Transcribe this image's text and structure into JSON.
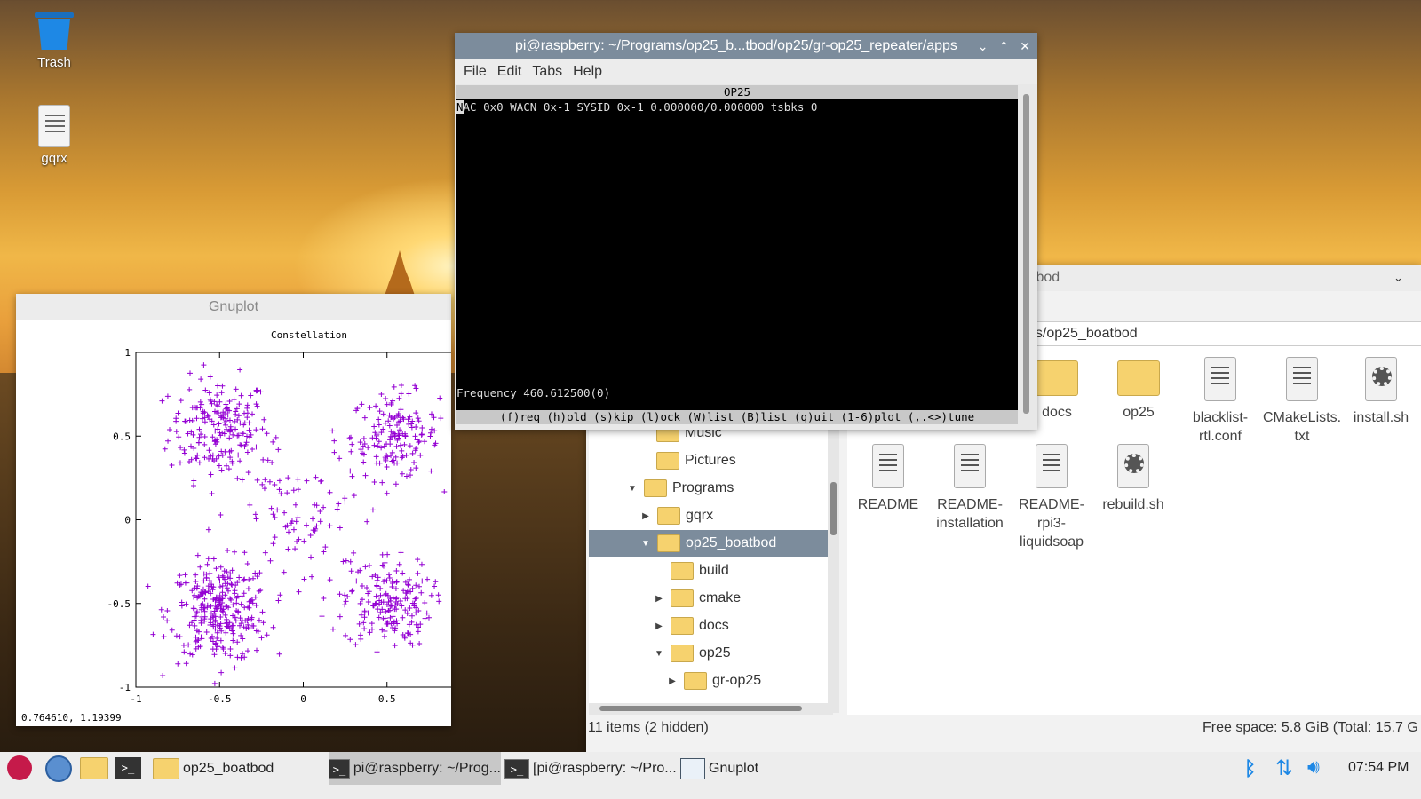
{
  "desktop": {
    "icons": [
      {
        "label": "Trash"
      },
      {
        "label": "gqrx"
      }
    ]
  },
  "gnuplot": {
    "window_title": "Gnuplot",
    "status_coords": "0.764610,  1.19399",
    "chart_data": {
      "type": "scatter",
      "title": "Constellation",
      "xlabel": "",
      "ylabel": "",
      "xlim": [
        -1,
        1
      ],
      "ylim": [
        -1,
        1
      ],
      "xticks": [
        "-1",
        "-0.5",
        "0",
        "0.5",
        "1"
      ],
      "yticks": [
        "1",
        "0.5",
        "0",
        "-0.5",
        "-1"
      ],
      "marker": "+",
      "color": "#9400d3",
      "clusters": [
        {
          "center": [
            -0.5,
            0.55
          ],
          "spread": 0.15,
          "n": 200
        },
        {
          "center": [
            0.55,
            0.5
          ],
          "spread": 0.13,
          "n": 160
        },
        {
          "center": [
            -0.5,
            -0.55
          ],
          "spread": 0.15,
          "n": 300
        },
        {
          "center": [
            0.5,
            -0.5
          ],
          "spread": 0.13,
          "n": 180
        },
        {
          "center": [
            0.0,
            0.0
          ],
          "spread": 0.22,
          "n": 90
        }
      ]
    }
  },
  "terminal": {
    "window_title": "pi@raspberry: ~/Programs/op25_b...tbod/op25/gr-op25_repeater/apps",
    "menu": [
      "File",
      "Edit",
      "Tabs",
      "Help"
    ],
    "header": "OP25",
    "cursor_char": "N",
    "line1": "AC 0x0 WACN 0x-1 SYSID 0x-1 0.000000/0.000000 tsbks 0",
    "frequency_line": "Frequency 460.612500(0)",
    "footer": "(f)req (h)old (s)kip (l)ock (W)list (B)list (q)uit (1-6)plot (,.<>)tune"
  },
  "file_manager": {
    "window_title": "tbod",
    "path": "ns/op25_boatbod",
    "tree": [
      {
        "label": "Music",
        "arrow": ""
      },
      {
        "label": "Pictures",
        "arrow": ""
      },
      {
        "label": "Programs",
        "arrow": "▼"
      },
      {
        "label": "gqrx",
        "arrow": "▶"
      },
      {
        "label": "op25_boatbod",
        "arrow": "▼"
      },
      {
        "label": "build",
        "arrow": ""
      },
      {
        "label": "cmake",
        "arrow": "▶"
      },
      {
        "label": "docs",
        "arrow": "▶"
      },
      {
        "label": "op25",
        "arrow": "▼"
      },
      {
        "label": "gr-op25",
        "arrow": "▶"
      }
    ],
    "files": [
      {
        "label": "docs",
        "kind": "folder"
      },
      {
        "label": "op25",
        "kind": "folder"
      },
      {
        "label": "blacklist-\nrtl.conf",
        "kind": "doc"
      },
      {
        "label": "CMakeLists.\ntxt",
        "kind": "doc"
      },
      {
        "label": "install.sh",
        "kind": "script"
      },
      {
        "label": "README",
        "kind": "doc"
      },
      {
        "label": "README-\ninstallation",
        "kind": "doc"
      },
      {
        "label": "README-\nrpi3-\nliquidsoap",
        "kind": "doc"
      },
      {
        "label": "rebuild.sh",
        "kind": "script"
      }
    ],
    "status_left": "11 items (2 hidden)",
    "status_right": "Free space: 5.8 GiB (Total: 15.7 G"
  },
  "taskbar": {
    "items": [
      {
        "label": "op25_boatbod"
      },
      {
        "label": "pi@raspberry: ~/Prog..."
      },
      {
        "label": "[pi@raspberry: ~/Pro..."
      },
      {
        "label": "Gnuplot"
      }
    ],
    "clock": "07:54 PM"
  }
}
